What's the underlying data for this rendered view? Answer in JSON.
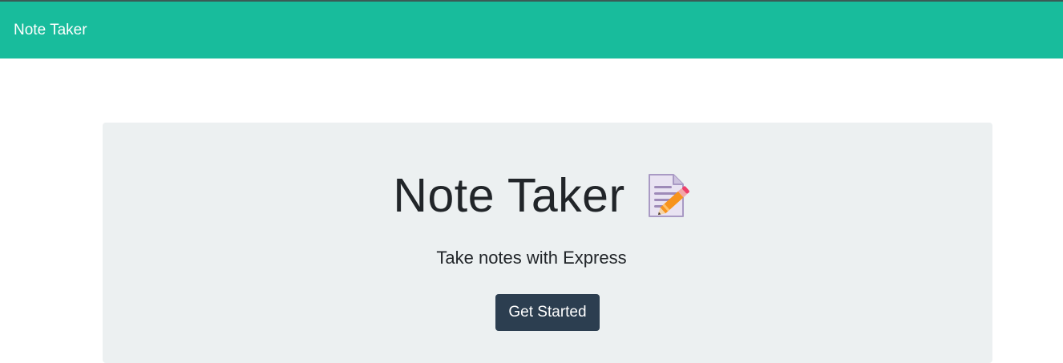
{
  "navbar": {
    "brand": "Note Taker",
    "color": "#18bc9c"
  },
  "hero": {
    "title": "Note Taker",
    "icon": "memo-icon",
    "subtitle": "Take notes with Express",
    "button_label": "Get Started",
    "background": "#ecf0f1",
    "button_color": "#2c3e50"
  }
}
